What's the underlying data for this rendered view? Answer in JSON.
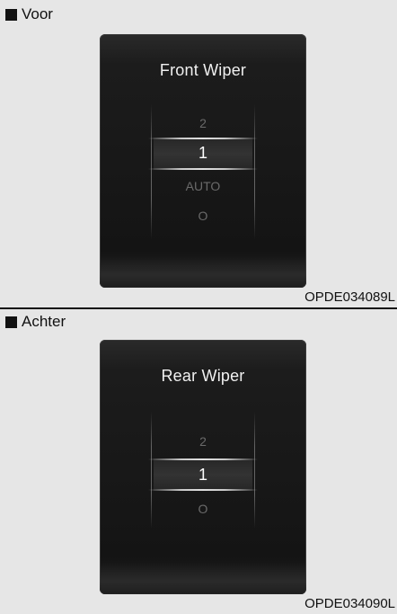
{
  "front": {
    "header": "Voor",
    "title": "Front Wiper",
    "options": [
      "2",
      "1",
      "AUTO",
      "O"
    ],
    "selected": "1",
    "caption": "OPDE034089L"
  },
  "rear": {
    "header": "Achter",
    "title": "Rear Wiper",
    "options": [
      "2",
      "1",
      "O"
    ],
    "selected": "1",
    "caption": "OPDE034090L"
  }
}
